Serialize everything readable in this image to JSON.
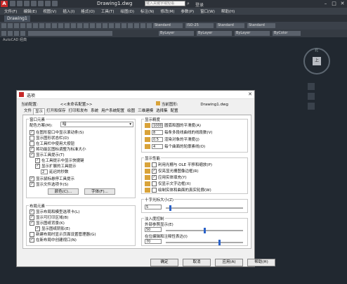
{
  "app": {
    "doc_title": "Drawing1.dwg",
    "search_placeholder": "键入关键字或短语",
    "login": "登录",
    "window_controls": [
      "–",
      "□",
      "✕"
    ]
  },
  "menu": [
    "文件(F)",
    "编辑(E)",
    "视图(V)",
    "插入(I)",
    "格式(O)",
    "工具(T)",
    "绘图(D)",
    "标注(N)",
    "修改(M)",
    "参数(P)",
    "窗口(W)",
    "帮助(H)"
  ],
  "doc_tab": "Drawing1",
  "toolbar": {
    "style_combo": "Standard",
    "dim_combo": "ISO-25",
    "table_combo": "Standard",
    "mleader_combo": "Standard",
    "bylayer_1": "ByLayer",
    "bylayer_2": "ByLayer",
    "bylayer_3": "ByLayer",
    "bycolor": "ByColor"
  },
  "canvas": {
    "label": "AutoCAD 经典",
    "viewcube_face": "上",
    "viewcube_north": "北"
  },
  "dialog": {
    "title": "选项",
    "current_profile_label": "当前配置:",
    "current_profile_value": "<<未命名配置>>",
    "current_drawing_label": "当前图形:",
    "current_drawing_value": "Drawing1.dwg",
    "tabs": [
      "文件",
      "显示",
      "打开和保存",
      "打印和发布",
      "系统",
      "用户系统配置",
      "绘图",
      "三维建模",
      "选择集",
      "配置"
    ],
    "active_tab": 1,
    "window_elements": {
      "title": "窗口元素",
      "color_scheme_label": "配色方案(M):",
      "color_scheme_value": "暗",
      "items": [
        {
          "label": "在图形窗口中显示滚动条(S)",
          "checked": true
        },
        {
          "label": "显示图形状态栏(D)",
          "checked": false
        },
        {
          "label": "在工具栏中使用大按钮",
          "checked": false
        },
        {
          "label": "将功能区图标调整为标准大小",
          "checked": true
        },
        {
          "label": "显示工具提示(T)",
          "checked": true
        },
        {
          "label": "在工具提示中显示快捷键",
          "checked": true
        },
        {
          "label": "显示扩展的工具提示",
          "checked": true
        },
        {
          "label": "延迟的秒数",
          "checked": false,
          "value": "2"
        },
        {
          "label": "显示鼠标悬停工具提示",
          "checked": true
        },
        {
          "label": "显示文件选项卡(S)",
          "checked": true
        }
      ],
      "colors_button": "颜色(C)...",
      "fonts_button": "字体(F)..."
    },
    "layout_elements": {
      "title": "布局元素",
      "items": [
        {
          "label": "显示布局和模型选项卡(L)",
          "checked": true
        },
        {
          "label": "显示可打印区域(B)",
          "checked": true
        },
        {
          "label": "显示图纸背景(K)",
          "checked": true
        },
        {
          "label": "显示图纸阴影(E)",
          "checked": true
        },
        {
          "label": "新建布局时显示页面设置管理器(G)",
          "checked": false
        },
        {
          "label": "在新布局中创建视口(N)",
          "checked": true
        }
      ]
    },
    "display_resolution": {
      "title": "显示精度",
      "items": [
        {
          "value": "1000",
          "label": "圆弧和圆的平滑度(A)"
        },
        {
          "value": "8",
          "label": "每条多段线曲线的线段数(V)"
        },
        {
          "value": "0.5",
          "label": "渲染对象的平滑度(J)"
        },
        {
          "value": "4",
          "label": "每个曲面的轮廓素线(O)"
        }
      ]
    },
    "display_performance": {
      "title": "显示性能",
      "items": [
        {
          "label": "利用光栅与 OLE 平移和缩放(P)",
          "checked": false
        },
        {
          "label": "仅亮显光栅图像边框(R)",
          "checked": true
        },
        {
          "label": "应用实体填充(Y)",
          "checked": true
        },
        {
          "label": "仅显示文字边框(X)",
          "checked": false
        },
        {
          "label": "绘制实体和曲面的真实轮廓(W)",
          "checked": false
        }
      ]
    },
    "crosshair": {
      "title": "十字光标大小(Z)",
      "value": "5",
      "fraction": 0.05
    },
    "fade": {
      "title": "淡入度控制",
      "xref_label": "外部参照显示(E)",
      "xref_value": "50",
      "xref_fraction": 0.5,
      "inplace_label": "在位编辑和注释性表达(I)",
      "inplace_value": "70",
      "inplace_fraction": 0.7
    },
    "buttons": [
      "确定",
      "取消",
      "应用(A)",
      "帮助(H)"
    ]
  }
}
